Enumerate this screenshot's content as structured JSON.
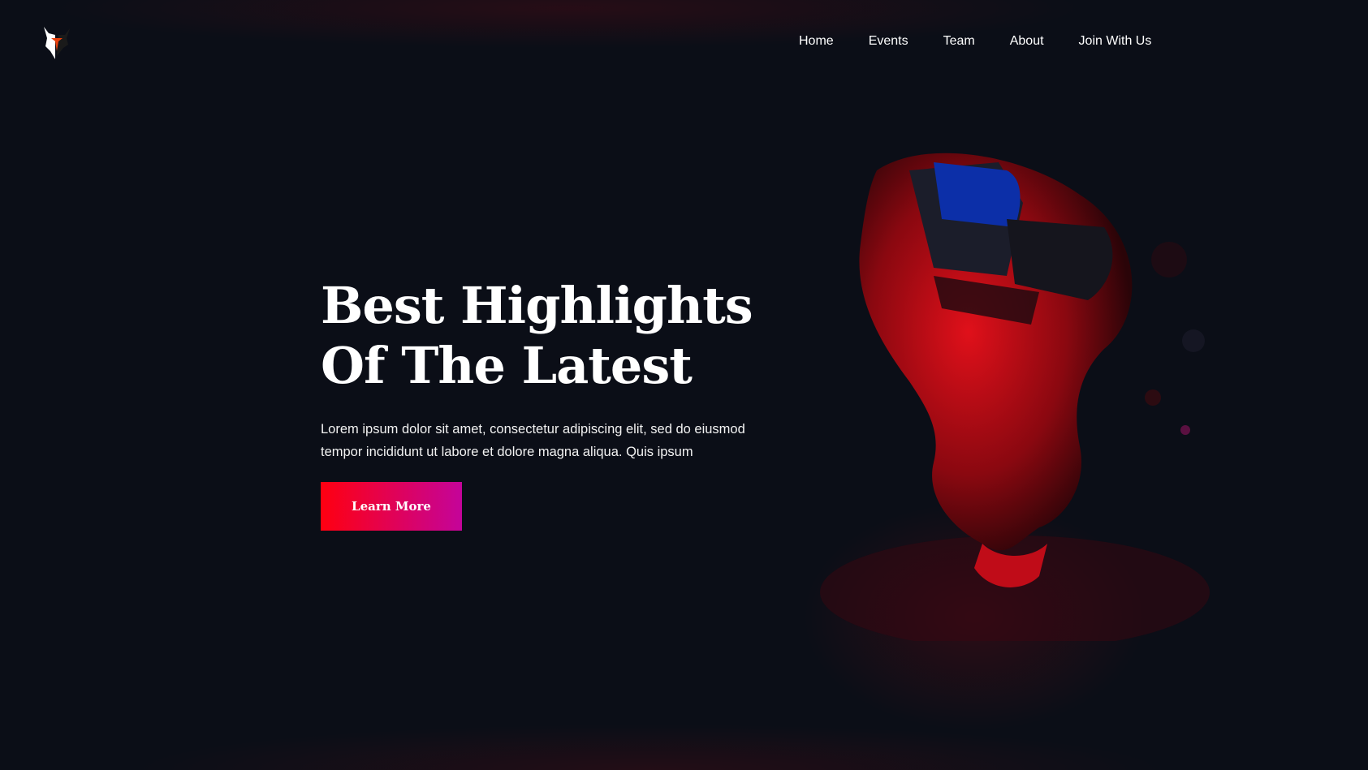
{
  "brand": {
    "logo": "wolf-mask-logo"
  },
  "nav": {
    "items": [
      {
        "label": "Home"
      },
      {
        "label": "Events"
      },
      {
        "label": "Team"
      },
      {
        "label": "About"
      },
      {
        "label": "Join With Us"
      }
    ]
  },
  "hero": {
    "title_line1": "Best Highlights",
    "title_line2": "Of The Latest",
    "description": "Lorem ipsum dolor sit amet, consectetur adipiscing elit, sed do eiusmod tempor incididunt ut labore et dolore magna aliqua. Quis ipsum",
    "cta_label": "Learn More"
  },
  "colors": {
    "background": "#0b0e17",
    "accent_start": "#ff0010",
    "accent_end": "#c4049a"
  }
}
